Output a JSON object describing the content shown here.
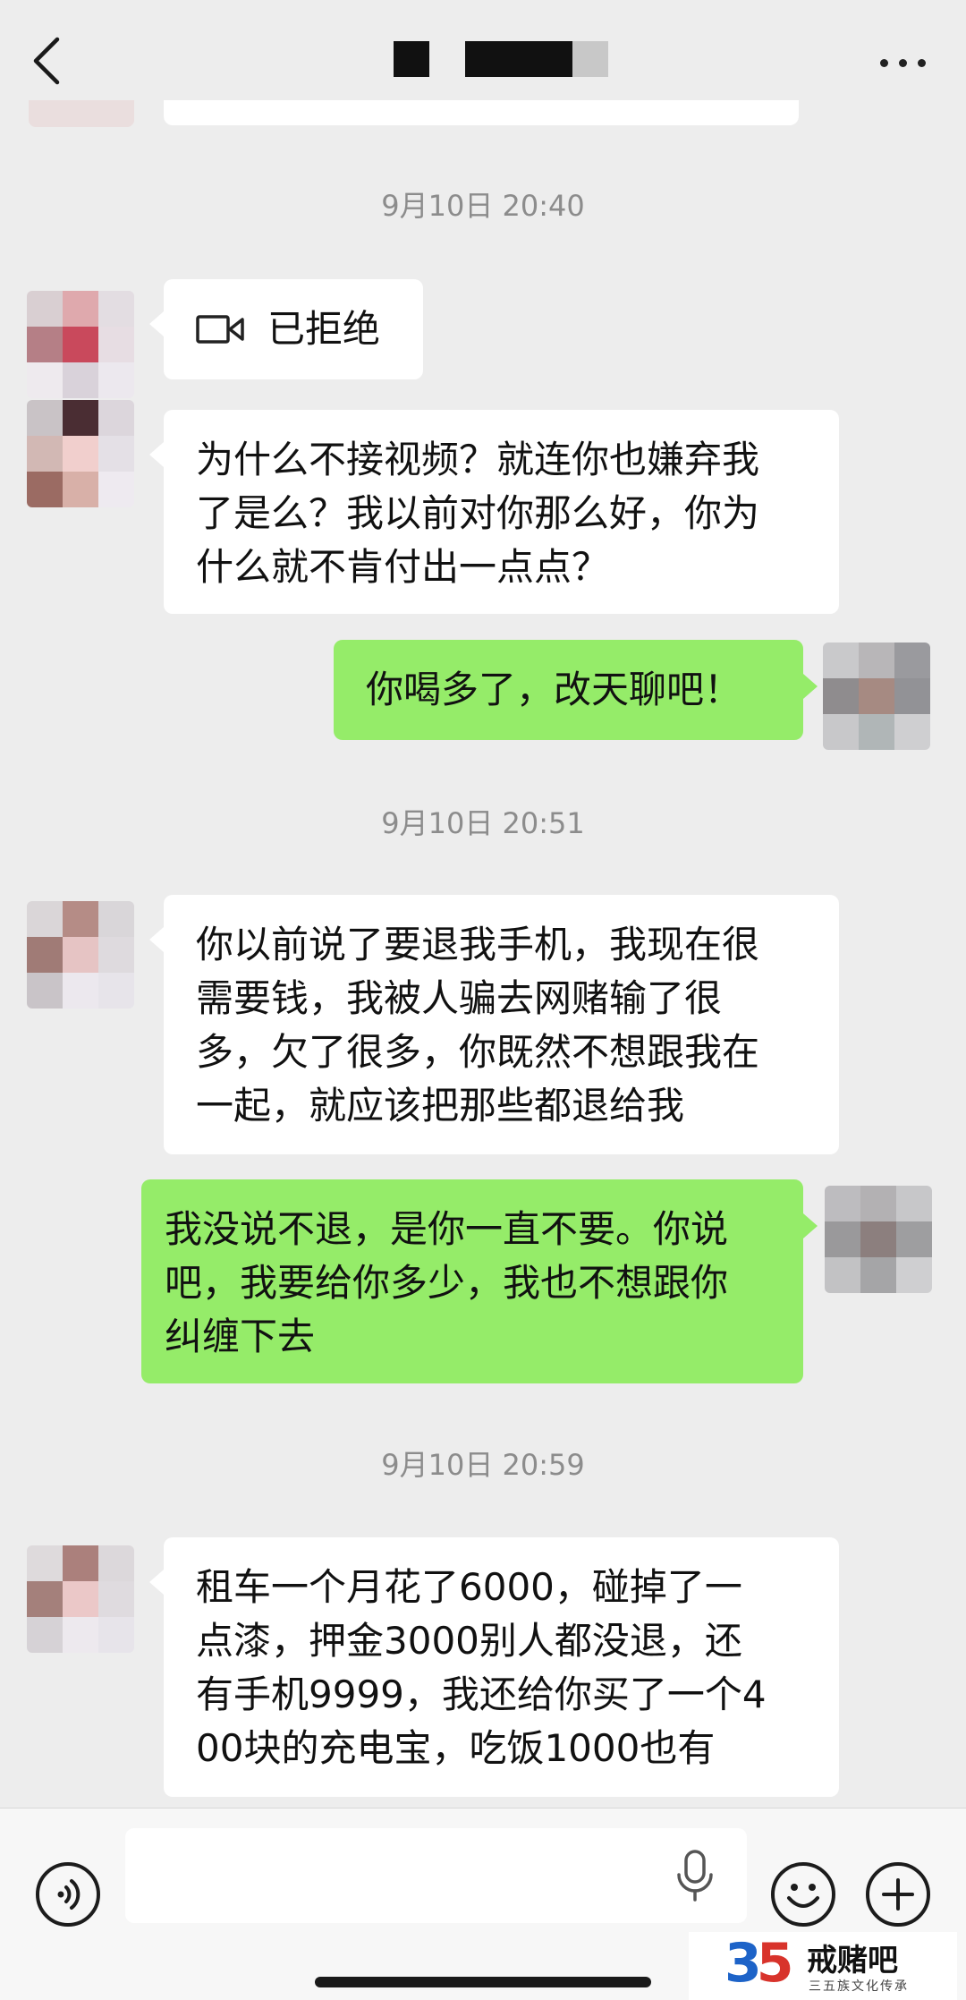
{
  "header": {
    "back_icon": "chevron-left-icon",
    "more_icon": "more-horizontal-icon"
  },
  "messages": [
    {
      "type": "timestamp",
      "text": "9月10日 20:40"
    },
    {
      "type": "call",
      "side": "left",
      "icon": "video-camera-icon",
      "text": "已拒绝"
    },
    {
      "type": "text",
      "side": "left",
      "text": "为什么不接视频？就连你也嫌弃我\n了是么？我以前对你那么好，你为\n什么就不肯付出一点点？"
    },
    {
      "type": "text",
      "side": "right",
      "text": "你喝多了，改天聊吧！"
    },
    {
      "type": "timestamp",
      "text": "9月10日 20:51"
    },
    {
      "type": "text",
      "side": "left",
      "text": "你以前说了要退我手机，我现在很\n需要钱，我被人骗去网赌输了很\n多，欠了很多，你既然不想跟我在\n一起，就应该把那些都退给我"
    },
    {
      "type": "text",
      "side": "right",
      "text": "我没说不退，是你一直不要。你说\n吧，我要给你多少，我也不想跟你\n纠缠下去"
    },
    {
      "type": "timestamp",
      "text": "9月10日 20:59"
    },
    {
      "type": "text",
      "side": "left",
      "text": "租车一个月花了6000，碰掉了一\n点漆，押金3000别人都没退，还\n有手机9999，我还给你买了一个4\n00块的充电宝，吃饭1000也有"
    }
  ],
  "bottom_bar": {
    "voice_icon": "voice-mode-icon",
    "mic_icon": "microphone-icon",
    "emoji_icon": "emoji-icon",
    "plus_icon": "plus-icon"
  },
  "watermark": {
    "number": "35",
    "name": "戒赌吧",
    "subtitle": "三五族文化传承"
  },
  "colors": {
    "background": "#ededed",
    "bubble_left": "#ffffff",
    "bubble_right": "#95ec69",
    "timestamp": "#8c8c8c"
  }
}
